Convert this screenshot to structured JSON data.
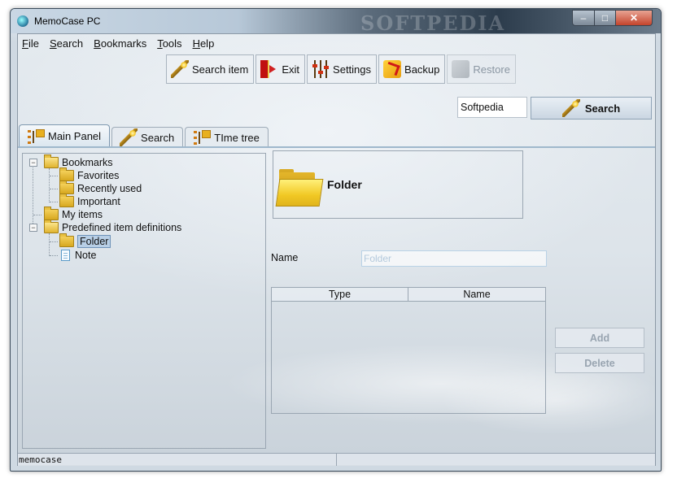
{
  "window": {
    "title": "MemoCase PC",
    "watermark": "SOFTPEDIA",
    "controls": {
      "minimize": "–",
      "maximize": "□",
      "close": "✕"
    }
  },
  "menubar": [
    {
      "key": "F",
      "rest": "ile"
    },
    {
      "key": "S",
      "rest": "earch"
    },
    {
      "key": "B",
      "rest": "ookmarks"
    },
    {
      "key": "T",
      "rest": "ools"
    },
    {
      "key": "H",
      "rest": "elp"
    }
  ],
  "toolbar": {
    "search_item": "Search item",
    "exit": "Exit",
    "settings": "Settings",
    "backup": "Backup",
    "restore": "Restore"
  },
  "search": {
    "value": "Softpedia",
    "button": "Search"
  },
  "tabs": {
    "main_panel": "Main Panel",
    "search": "Search",
    "time_tree": "TIme tree"
  },
  "tree": {
    "bookmarks": "Bookmarks",
    "favorites": "Favorites",
    "recently_used": "Recently used",
    "important": "Important",
    "my_items": "My items",
    "predefined": "Predefined item definitions",
    "folder": "Folder",
    "note": "Note",
    "toggle_open": "−"
  },
  "detail": {
    "header_title": "Folder",
    "name_label": "Name",
    "name_placeholder": "Folder",
    "table_headers": {
      "type": "Type",
      "name": "Name"
    },
    "add_button": "Add",
    "delete_button": "Delete"
  },
  "statusbar": {
    "text": "memocase"
  },
  "colors": {
    "tab_accent": "#9fb8cc",
    "disabled_text": "#98a4b0",
    "close_button": "#c4442c"
  }
}
